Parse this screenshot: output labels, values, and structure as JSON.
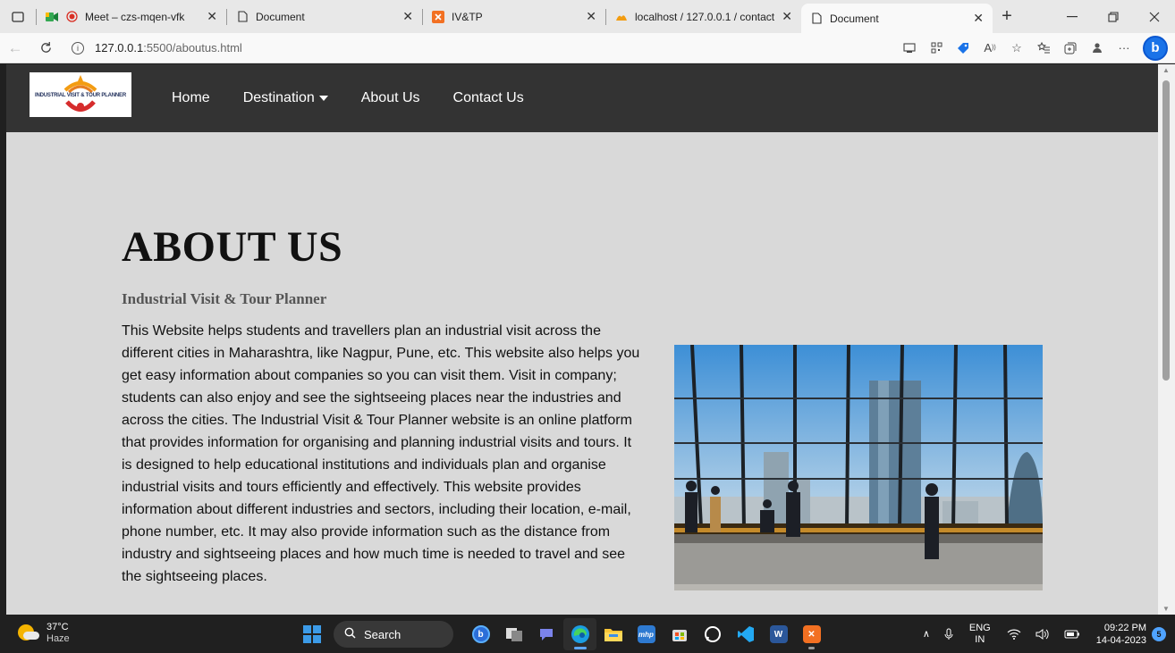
{
  "browser": {
    "tabs": [
      {
        "title": "Meet – czs-mqen-vfk",
        "active": false
      },
      {
        "title": "Document",
        "active": false
      },
      {
        "title": "IV&TP",
        "active": false
      },
      {
        "title": "localhost / 127.0.0.1 / contact",
        "active": false
      },
      {
        "title": "Document",
        "active": true
      }
    ],
    "new_tab_label": "+",
    "url_host": "127.0.0.1",
    "url_path": ":5500/aboutus.html"
  },
  "site": {
    "logo_text": "INDUSTRIAL VISIT & TOUR PLANNER",
    "nav": {
      "home": "Home",
      "destination": "Destination",
      "about": "About Us",
      "contact": "Contact Us"
    },
    "about": {
      "title": "ABOUT US",
      "subtitle": "Industrial Visit & Tour Planner",
      "body": "This Website helps students and travellers plan an industrial visit across the different cities in Maharashtra, like Nagpur, Pune, etc. This website also helps you get easy information about companies so you can visit them. Visit in company; students can also enjoy and see the sightseeing places near the industries and across the cities. The Industrial Visit & Tour Planner website is an online platform that provides information for organising and planning industrial visits and tours. It is designed to help educational institutions and individuals plan and organise industrial visits and tours efficiently and effectively. This website provides information about different industries and sectors, including their location, e-mail, phone number, etc. It may also provide information such as the distance from industry and sightseeing places and how much time is needed to travel and see the sightseeing places."
    }
  },
  "taskbar": {
    "weather_temp": "37°C",
    "weather_cond": "Haze",
    "search_label": "Search",
    "lang_top": "ENG",
    "lang_bottom": "IN",
    "time": "09:22 PM",
    "date": "14-04-2023",
    "notifications": "5"
  },
  "colors": {
    "site_nav_bg": "#333333",
    "page_bg": "#d9d9d9",
    "taskbar_bg": "#202020",
    "accent": "#1a73e8"
  }
}
